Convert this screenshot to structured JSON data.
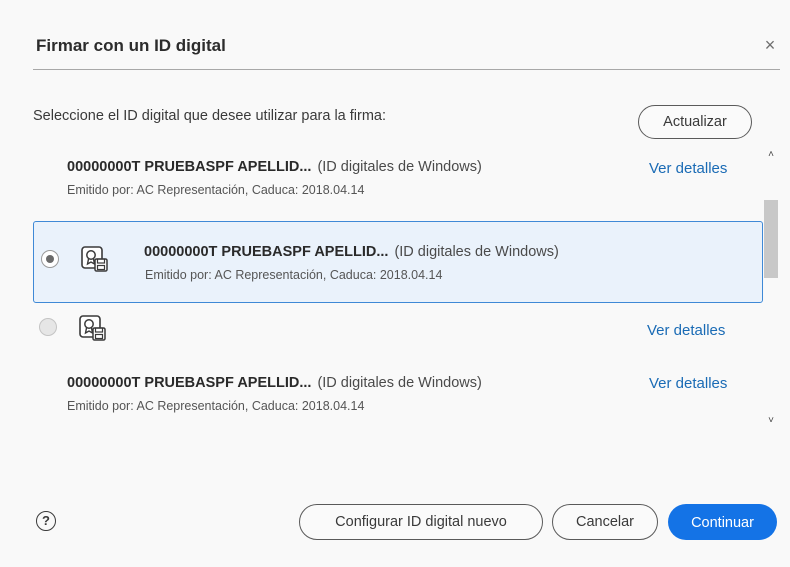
{
  "dialog": {
    "title": "Firmar con un ID digital",
    "close_label": "×",
    "instruction": "Seleccione el ID digital que desee utilizar para la firma:",
    "refresh_label": "Actualizar"
  },
  "ids": [
    {
      "name": "00000000T PRUEBASPF APELLID...",
      "source": "(ID digitales de Windows)",
      "details": "Emitido por: AC Representación, Caduca: 2018.04.14",
      "link": "Ver detalles"
    },
    {
      "name": "00000000T PRUEBASPF APELLID...",
      "source": "(ID digitales de Windows)",
      "details": "Emitido por: AC Representación, Caduca: 2018.04.14",
      "selected": true
    },
    {
      "link": "Ver detalles"
    },
    {
      "name": "00000000T PRUEBASPF APELLID...",
      "source": "(ID digitales de Windows)",
      "details": "Emitido por: AC Representación, Caduca: 2018.04.14",
      "link": "Ver detalles"
    }
  ],
  "scroll": {
    "up": "˄",
    "down": "˅"
  },
  "footer": {
    "help": "?",
    "configure_label": "Configurar ID digital nuevo",
    "cancel_label": "Cancelar",
    "continue_label": "Continuar"
  },
  "colors": {
    "accent": "#1473e6",
    "link": "#1a6bb5",
    "selected_border": "#3f89d6",
    "selected_bg": "#eaf2fb"
  },
  "icons": [
    "close-icon",
    "certificate-icon",
    "help-icon",
    "chevron-up-icon",
    "chevron-down-icon"
  ]
}
